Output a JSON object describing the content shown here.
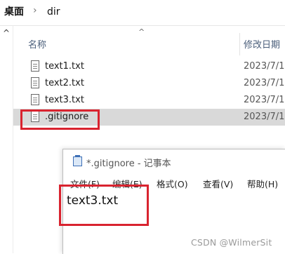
{
  "explorer": {
    "breadcrumb": [
      "桌面",
      "dir"
    ],
    "breadcrumb_separator": "›",
    "nav_collapse_glyph": "^",
    "sort_indicator": "^",
    "columns": {
      "name": "名称",
      "date_modified": "修改日期"
    },
    "files": [
      {
        "name": "text1.txt",
        "date": "2023/7/1",
        "selected": false,
        "icon": "text-file-icon"
      },
      {
        "name": "text2.txt",
        "date": "2023/7/1",
        "selected": false,
        "icon": "text-file-icon"
      },
      {
        "name": "text3.txt",
        "date": "2023/7/1",
        "selected": false,
        "icon": "text-file-icon"
      },
      {
        "name": ".gitignore",
        "date": "2023/7/1",
        "selected": true,
        "icon": "text-file-icon"
      }
    ]
  },
  "notepad": {
    "title": "*.gitignore - 记事本",
    "menu": [
      "文件(F)",
      "编辑(E)",
      "格式(O)",
      "查看(V)",
      "帮助(H)"
    ],
    "content": "text3.txt"
  },
  "annotation_color": "#d9232f",
  "selection_color": "#d9d9d9",
  "watermark": "CSDN @WilmerSit"
}
